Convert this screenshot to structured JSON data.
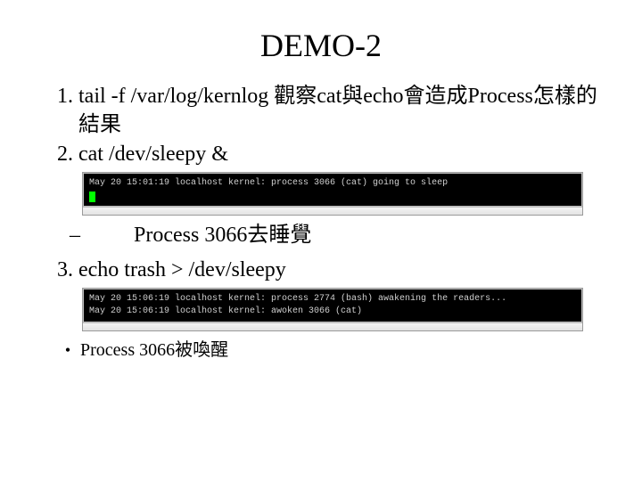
{
  "title": "DEMO‐2",
  "items": {
    "item1": {
      "num": "1.",
      "text": "tail -f /var/log/kernlog 觀察cat與echo會造成Process怎樣的結果"
    },
    "item2": {
      "num": "2.",
      "text": "cat /dev/sleepy &"
    },
    "term1": {
      "line1": "May 20 15:01:19 localhost kernel: process 3066 (cat) going to sleep"
    },
    "sub_dash": {
      "dash": "–",
      "text": "Process 3066去睡覺"
    },
    "item3": {
      "num": "3.",
      "text": "echo trash > /dev/sleepy"
    },
    "term2": {
      "line1": "May 20 15:06:19 localhost kernel: process 2774 (bash) awakening the readers...",
      "line2": "May 20 15:06:19 localhost kernel: awoken 3066 (cat)"
    },
    "sub_bullet": {
      "bullet": "•",
      "text": "Process 3066被喚醒"
    }
  }
}
